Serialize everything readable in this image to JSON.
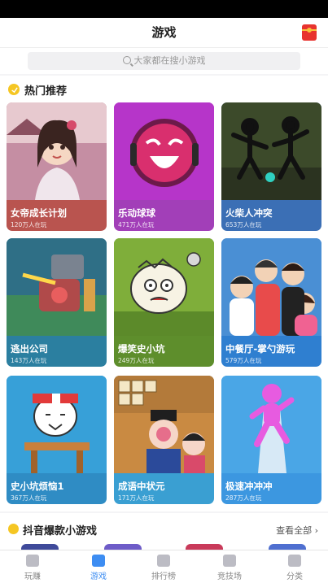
{
  "header": {
    "title": "游戏"
  },
  "search": {
    "placeholder": "大家都在搜小游戏"
  },
  "hot": {
    "title": "热门推荐",
    "games": [
      {
        "name": "女帝成长计划",
        "players": "120万人在玩",
        "icon": "girl-portrait",
        "bg": "#c58ea3"
      },
      {
        "name": "乐动球球",
        "players": "471万人在玩",
        "icon": "pink-ball",
        "bg": "#b635c9"
      },
      {
        "name": "火柴人冲突",
        "players": "653万人在玩",
        "icon": "stickman-fight",
        "bg": "#3c4a2a"
      },
      {
        "name": "逃出公司",
        "players": "143万人在玩",
        "icon": "robot-battle",
        "bg": "#2f6f86"
      },
      {
        "name": "爆笑史小坑",
        "players": "249万人在玩",
        "icon": "cartoon-face",
        "bg": "#7fae3a"
      },
      {
        "name": "中餐厅-掌勺游玩",
        "players": "579万人在玩",
        "icon": "celebrity-group",
        "bg": "#4a8fd4"
      },
      {
        "name": "史小坑烦恼1",
        "players": "367万人在玩",
        "icon": "student-desk",
        "bg": "#37a0d8"
      },
      {
        "name": "成语中状元",
        "players": "171万人在玩",
        "icon": "opera-scholar",
        "bg": "#c98a42"
      },
      {
        "name": "极速冲冲冲",
        "players": "287万人在玩",
        "icon": "pink-runner",
        "bg": "#4aa6e6"
      }
    ]
  },
  "douyin": {
    "title": "抖音爆款小游戏",
    "see_all": "查看全部"
  },
  "tabs": [
    {
      "label": "玩赚",
      "icon": "gift-icon",
      "active": false
    },
    {
      "label": "游戏",
      "icon": "gamepad-icon",
      "active": true
    },
    {
      "label": "排行榜",
      "icon": "trophy-icon",
      "active": false
    },
    {
      "label": "竞技场",
      "icon": "arena-icon",
      "active": false
    },
    {
      "label": "分类",
      "icon": "category-icon",
      "active": false
    }
  ]
}
